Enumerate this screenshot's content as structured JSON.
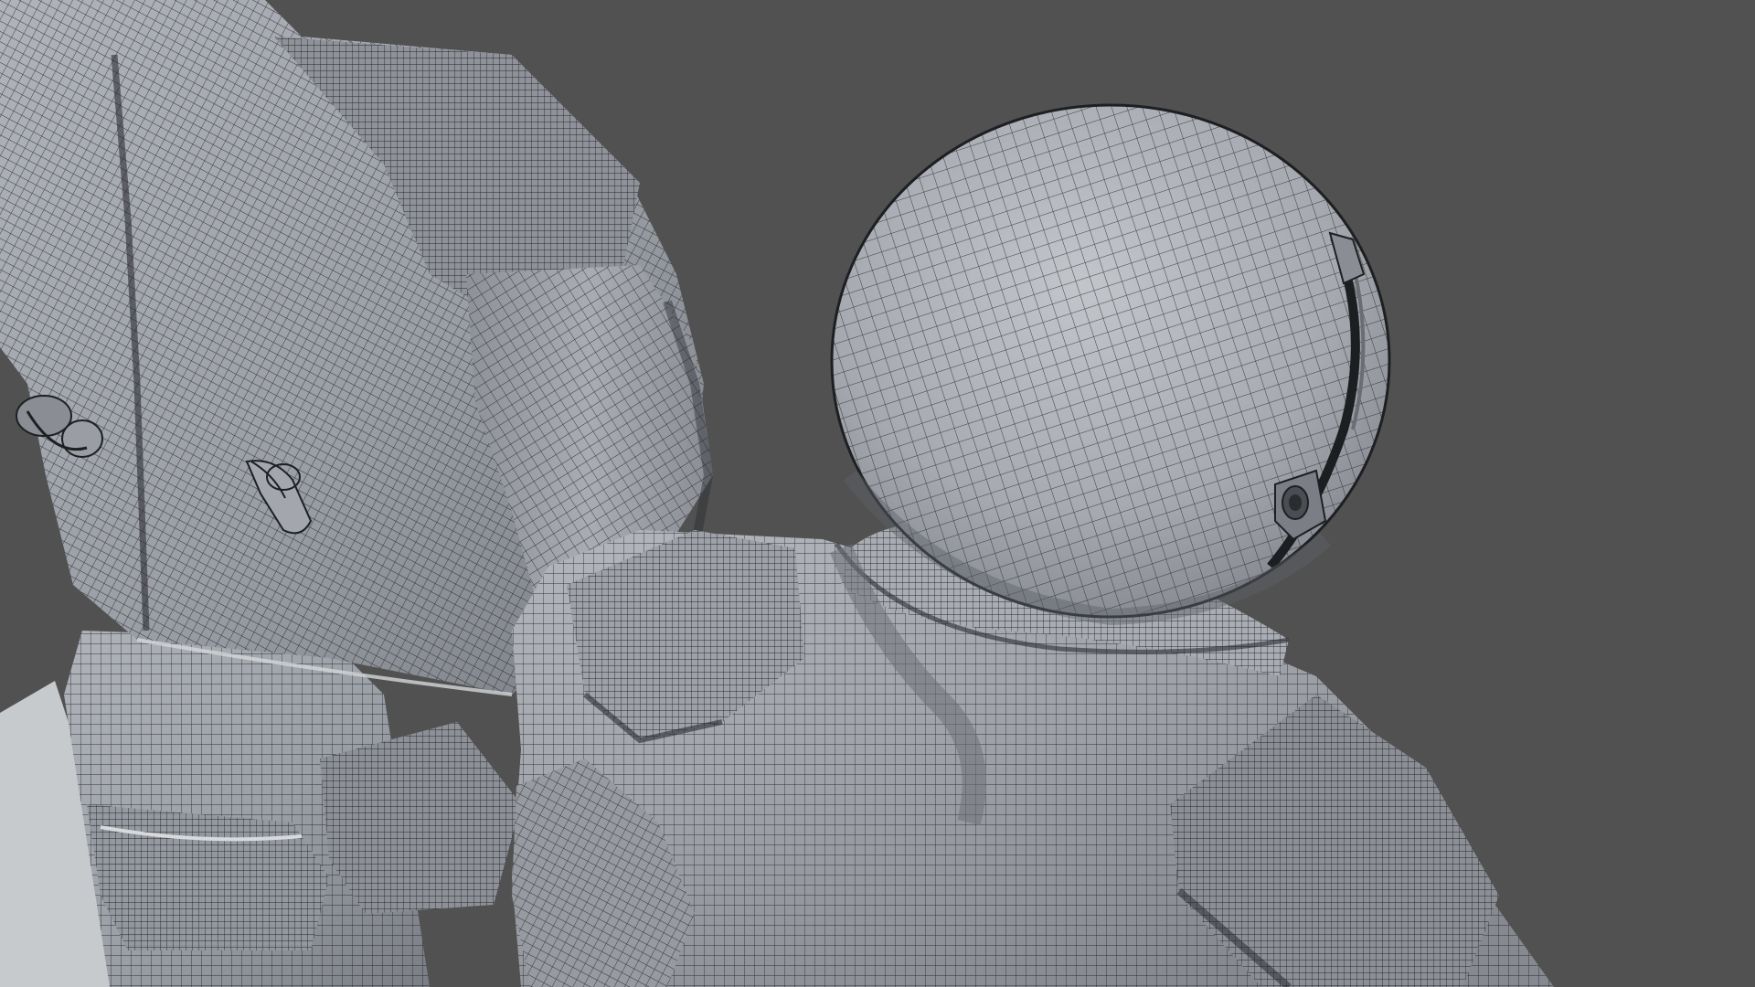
{
  "scene": {
    "subject": "two-astronaut-wireframe-models",
    "render_mode": "shaded-wireframe",
    "colors": {
      "background": "#515151",
      "floor": "#c7cacd",
      "surface_light": "#aeb2b8",
      "surface_mid": "#989ca3",
      "surface_dark": "#6f7379",
      "wire": "#1c1e21"
    },
    "objects": [
      {
        "id": "astronaut-back",
        "parts": [
          "torso",
          "arm",
          "hand",
          "leg",
          "hose-connector",
          "valve",
          "knee-pad"
        ]
      },
      {
        "id": "astronaut-front",
        "parts": [
          "helmet",
          "helmet-camera",
          "neck-ring",
          "shoulder-pad",
          "back",
          "arm"
        ]
      }
    ]
  }
}
